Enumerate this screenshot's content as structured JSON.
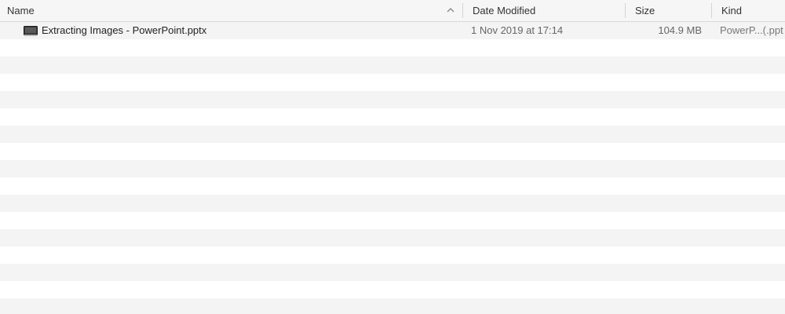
{
  "columns": {
    "name": "Name",
    "date_modified": "Date Modified",
    "size": "Size",
    "kind": "Kind"
  },
  "files": [
    {
      "icon": "presentation-file-icon",
      "name": "Extracting Images - PowerPoint.pptx",
      "date_modified": "1 Nov 2019 at 17:14",
      "size": "104.9 MB",
      "kind": "PowerP...(.ppt"
    }
  ]
}
